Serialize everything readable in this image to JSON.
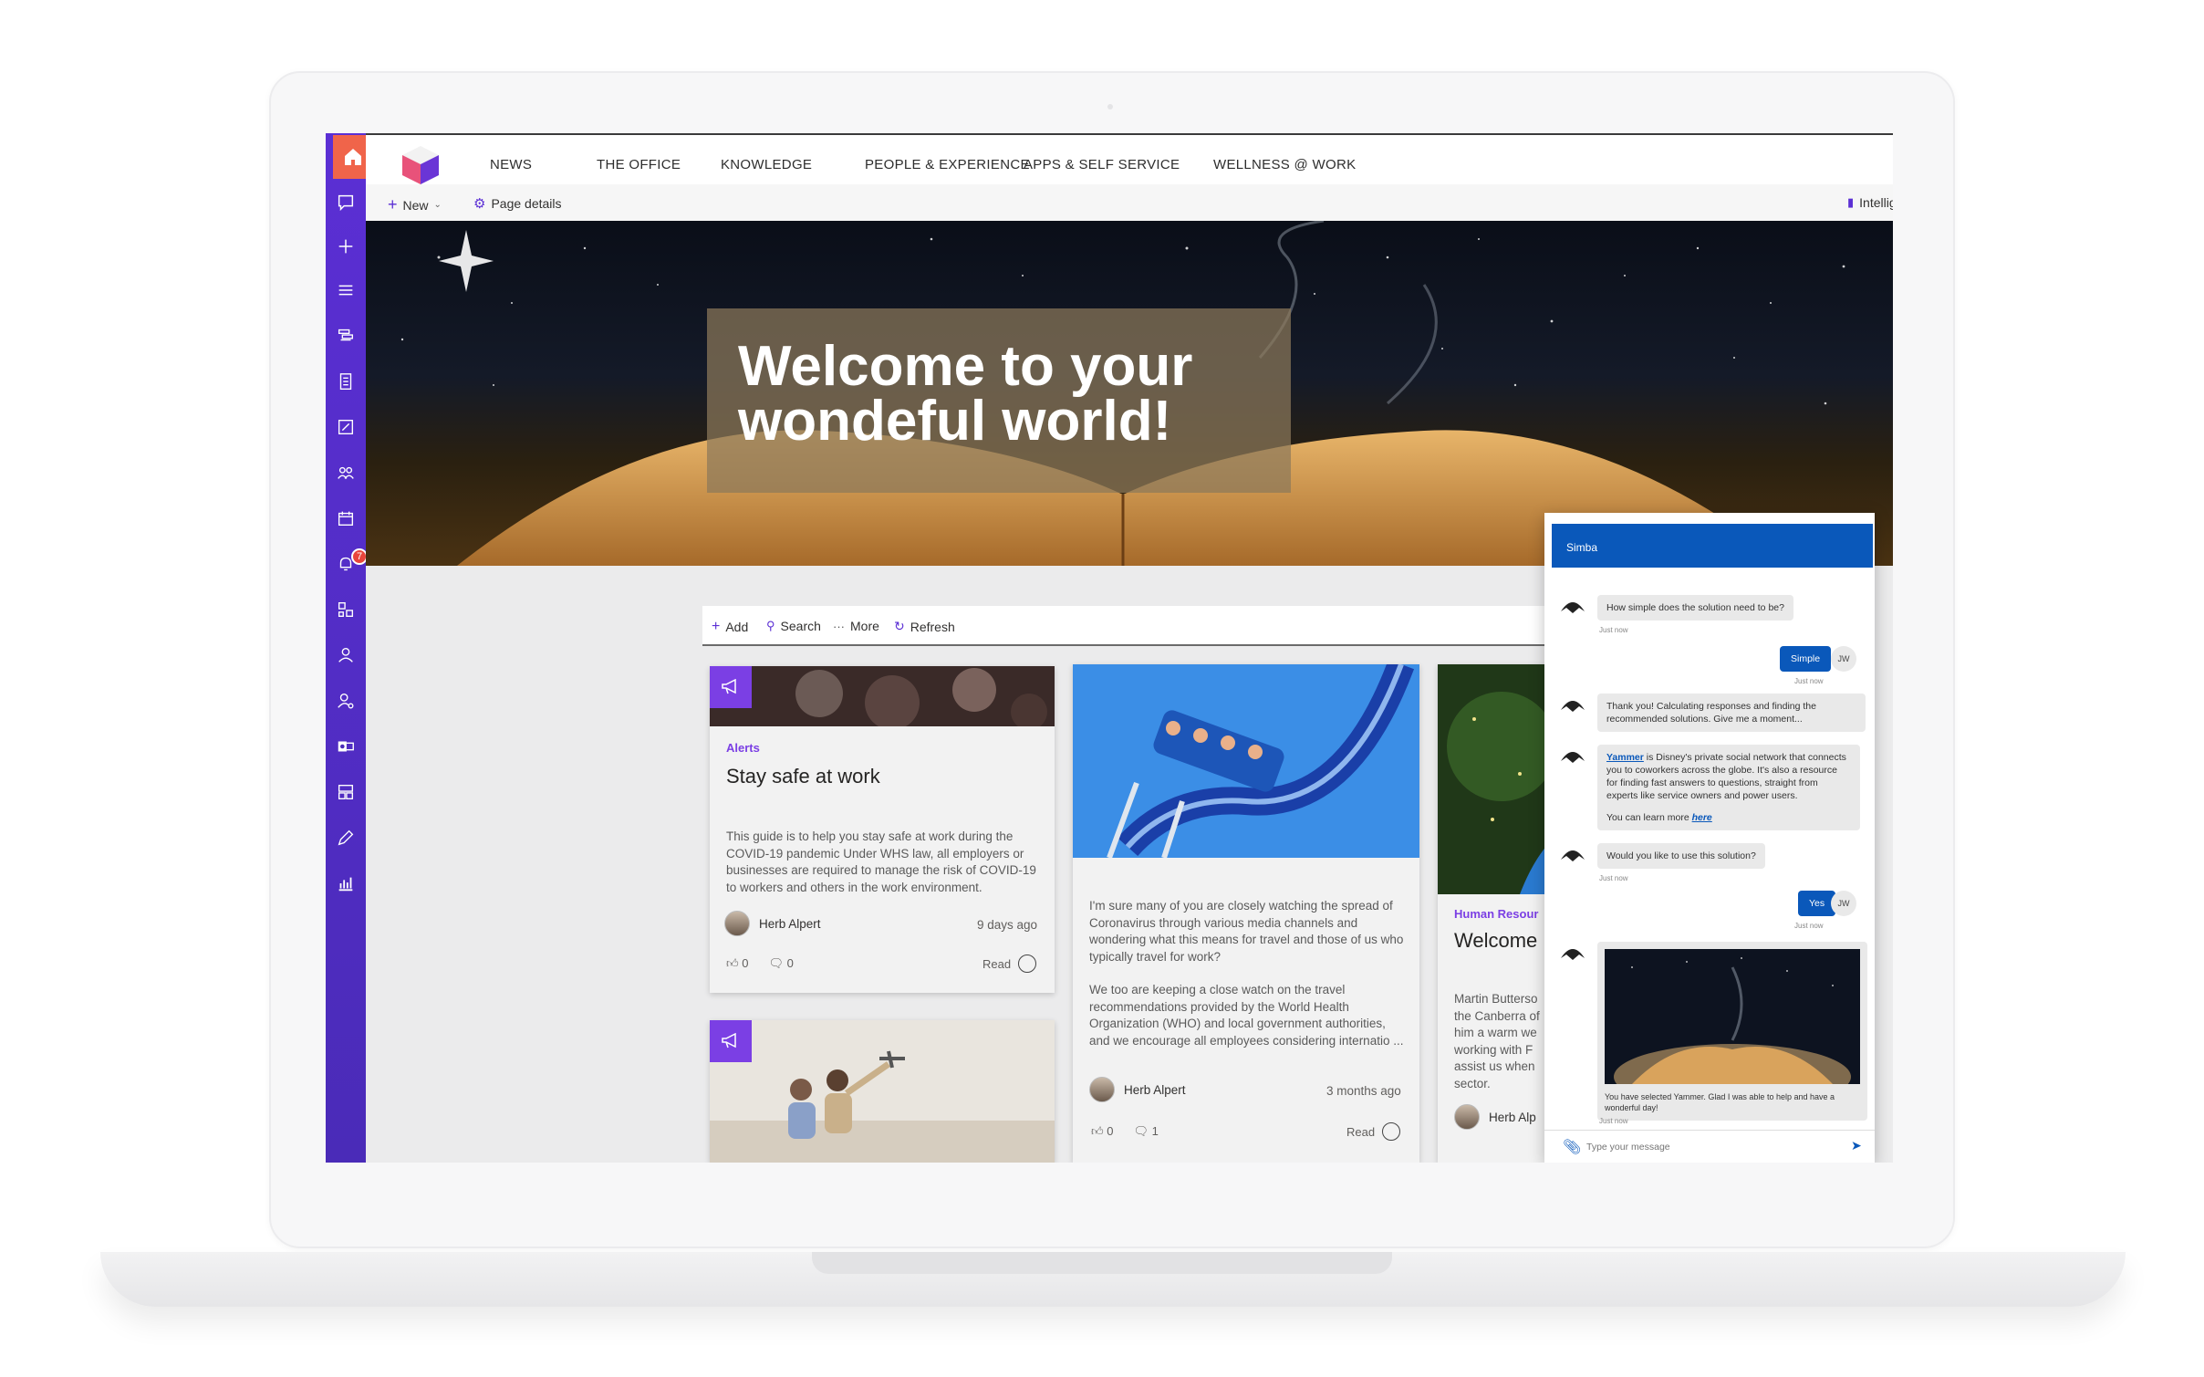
{
  "topnav": {
    "items": [
      "NEWS",
      "THE OFFICE",
      "KNOWLEDGE",
      "PEOPLE & EXPERIENCE",
      "APPS & SELF SERVICE",
      "WELLNESS @ WORK"
    ]
  },
  "rail": {
    "notification_count": "7"
  },
  "cmdbar": {
    "new_label": "New",
    "page_details_label": "Page details",
    "analytics_label": "Intellig"
  },
  "hero": {
    "title": "Welcome to your wondeful world!"
  },
  "content_toolbar": {
    "add": "Add",
    "search": "Search",
    "more": "More",
    "refresh": "Refresh"
  },
  "cards": [
    {
      "tag": "Alerts",
      "title": "Stay safe at work",
      "body": "This guide is to help you stay safe at work during the COVID-19 pandemic Under WHS law, all employers or businesses are required to manage the risk of COVID-19 to workers and others in the work environment.",
      "author": "Herb Alpert",
      "time": "9 days ago",
      "likes": "0",
      "comments": "0",
      "read": "Read"
    },
    {
      "body1": "I'm sure many of you are closely watching the spread of Coronavirus through various media channels and wondering what this means for travel and those of us who typically travel for work?",
      "body2": "We too are keeping a close watch on the travel recommendations provided by the World Health Organization (WHO) and local government authorities, and we encourage all employees considering internatio ...",
      "author": "Herb Alpert",
      "time": "3 months ago",
      "likes": "0",
      "comments": "1",
      "read": "Read"
    },
    {
      "tag": "Human Resour",
      "title": "Welcome",
      "body": "Martin Butterso the Canberra of him a warm we working with F assist us when sector.",
      "author": "Herb Alp"
    }
  ],
  "chat": {
    "title": "Simba",
    "q1": "How simple does the solution need to be?",
    "ts_just_now": "Just now",
    "a1": "Simple",
    "user_initials": "JW",
    "m2": "Thank you! Calculating responses and finding the recommended solutions. Give me a moment...",
    "m3_link": "Yammer",
    "m3_text": " is Disney's private social network that connects you to coworkers across the globe. It's also a resource for finding fast answers to questions, straight from experts like service owners and power users.",
    "m3_more": "You can learn more ",
    "m3_here": "here",
    "q2": "Would you like to use this solution?",
    "a2": "Yes",
    "m4": "You have selected Yammer. Glad I was able to help and have a wonderful day!",
    "input_placeholder": "Type your message"
  }
}
